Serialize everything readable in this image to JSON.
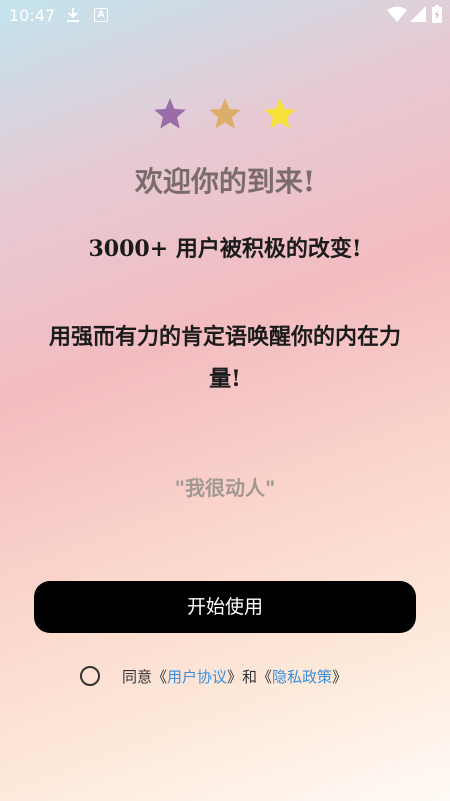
{
  "status_bar": {
    "time": "10:47",
    "icons": [
      "download-icon",
      "a-notification-icon",
      "wifi-icon",
      "signal-icon",
      "battery-icon"
    ]
  },
  "stars": [
    {
      "icon": "star-icon",
      "color": "#9a6ca8"
    },
    {
      "icon": "star-icon",
      "color": "#dcae6a"
    },
    {
      "icon": "star-icon",
      "color": "#f7e23a"
    }
  ],
  "welcome_title": "欢迎你的到来!",
  "users_text": "3000+ 用户被积极的改变!",
  "description": "用强而有力的肯定语唤醒你的内在力量!",
  "quote": "\"我很动人\"",
  "start_button": "开始使用",
  "agreement": {
    "prefix": "同意《",
    "user_agreement": "用户协议",
    "middle": "》和《",
    "privacy_policy": "隐私政策",
    "suffix": "》"
  },
  "colors": {
    "link": "#3c8ed9",
    "button": "#000000",
    "title": "#7b6c6c"
  }
}
